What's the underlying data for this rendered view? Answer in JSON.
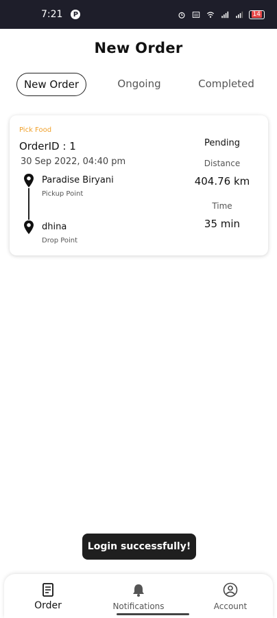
{
  "status_bar": {
    "time": "7:21",
    "app_badge": "P",
    "battery": "14",
    "icons": [
      "alarm-icon",
      "data-icon",
      "wifi-icon",
      "signal-icon",
      "signal-icon",
      "battery-icon"
    ]
  },
  "header": {
    "title": "New Order"
  },
  "tabs": [
    {
      "label": "New Order",
      "active": true
    },
    {
      "label": "Ongoing",
      "active": false
    },
    {
      "label": "Completed",
      "active": false
    }
  ],
  "order": {
    "type": "Pick Food",
    "order_id": "OrderID : 1",
    "date": "30 Sep 2022, 04:40 pm",
    "pickup": {
      "name": "Paradise Biryani",
      "label": "Pickup Point"
    },
    "drop": {
      "name": "dhina",
      "label": "Drop Point"
    },
    "status": "Pending",
    "distance_label": "Distance",
    "distance": "404.76 km",
    "time_label": "Time",
    "time": "35 min"
  },
  "toast": {
    "message": "Login successfully!"
  },
  "bottom_nav": [
    {
      "label": "Order",
      "icon": "order-icon",
      "active": true
    },
    {
      "label": "Notifications",
      "icon": "bell-icon",
      "active": false
    },
    {
      "label": "Account",
      "icon": "account-icon",
      "active": false
    }
  ],
  "colors": {
    "accent": "#f0a02a",
    "status_bar": "#1e1e2a",
    "toast_bg": "#1f1f1f"
  }
}
